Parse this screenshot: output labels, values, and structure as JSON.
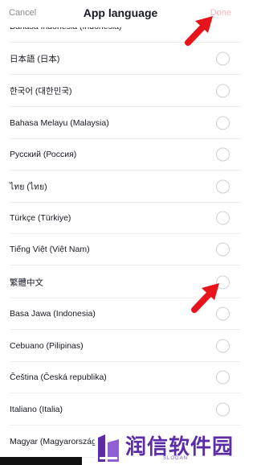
{
  "header": {
    "cancel_label": "Cancel",
    "title": "App language",
    "done_label": "Done"
  },
  "languages": [
    "Bahasa Indonesia (Indonesia)",
    "日本語 (日本)",
    "한국어 (대한민국)",
    "Bahasa Melayu (Malaysia)",
    "Русский (Россия)",
    "ไทย (ไทย)",
    "Türkçe (Türkiye)",
    "Tiếng Việt (Việt Nam)",
    "繁體中文",
    "Basa Jawa (Indonesia)",
    "Cebuano (Pilipinas)",
    "Čeština (Česká republika)",
    "Italiano (Italia)",
    "Magyar (Magyarország)"
  ],
  "watermark": {
    "text": "润信软件园",
    "slogan": "SLOGAN"
  },
  "colors": {
    "accent_disabled": "#f4b5bf",
    "arrow": "#e8141b",
    "watermark": "#5b2ca3"
  }
}
